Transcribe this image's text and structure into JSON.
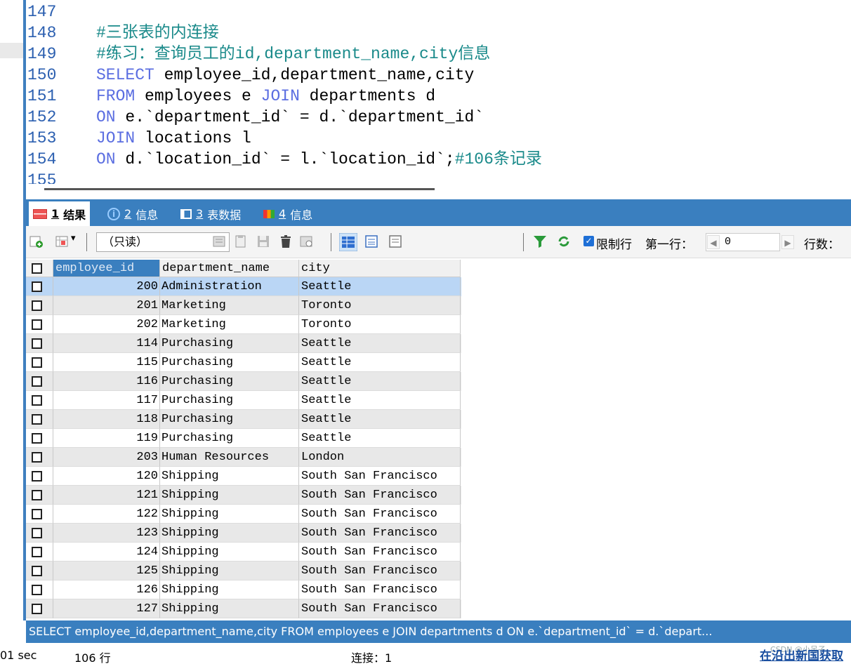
{
  "editor": {
    "lines": [
      {
        "num": "147",
        "parts": []
      },
      {
        "num": "148",
        "parts": [
          {
            "t": "cm",
            "v": "#三张表的内连接"
          }
        ]
      },
      {
        "num": "149",
        "parts": [
          {
            "t": "cm",
            "v": "#练习：查询员工的id,department_name,city信息"
          }
        ]
      },
      {
        "num": "150",
        "parts": [
          {
            "t": "kw",
            "v": "SELECT"
          },
          {
            "t": "str",
            "v": " employee_id,department_name,city"
          }
        ]
      },
      {
        "num": "151",
        "parts": [
          {
            "t": "kw",
            "v": "FROM"
          },
          {
            "t": "str",
            "v": " employees e "
          },
          {
            "t": "kw",
            "v": "JOIN"
          },
          {
            "t": "str",
            "v": " departments d"
          }
        ]
      },
      {
        "num": "152",
        "parts": [
          {
            "t": "kw",
            "v": "ON"
          },
          {
            "t": "str",
            "v": " e.`department_id` = d.`department_id`"
          }
        ]
      },
      {
        "num": "153",
        "parts": [
          {
            "t": "kw",
            "v": "JOIN"
          },
          {
            "t": "str",
            "v": " locations l"
          }
        ]
      },
      {
        "num": "154",
        "parts": [
          {
            "t": "kw",
            "v": "ON"
          },
          {
            "t": "str",
            "v": " d.`location_id` = l.`location_id`;"
          },
          {
            "t": "cm",
            "v": "#106条记录"
          }
        ]
      },
      {
        "num": "155",
        "parts": []
      }
    ]
  },
  "tabs": [
    {
      "num": "1",
      "label": "结果"
    },
    {
      "num": "2",
      "label": "信息"
    },
    {
      "num": "3",
      "label": "表数据"
    },
    {
      "num": "4",
      "label": "信息"
    }
  ],
  "toolbar": {
    "readonly": "（只读）",
    "limit_label": "限制行",
    "first_row_label": "第一行：",
    "first_row_value": "0",
    "rows_label": "行数："
  },
  "grid": {
    "columns": [
      "employee_id",
      "department_name",
      "city"
    ],
    "rows": [
      [
        "200",
        "Administration",
        "Seattle"
      ],
      [
        "201",
        "Marketing",
        "Toronto"
      ],
      [
        "202",
        "Marketing",
        "Toronto"
      ],
      [
        "114",
        "Purchasing",
        "Seattle"
      ],
      [
        "115",
        "Purchasing",
        "Seattle"
      ],
      [
        "116",
        "Purchasing",
        "Seattle"
      ],
      [
        "117",
        "Purchasing",
        "Seattle"
      ],
      [
        "118",
        "Purchasing",
        "Seattle"
      ],
      [
        "119",
        "Purchasing",
        "Seattle"
      ],
      [
        "203",
        "Human Resources",
        "London"
      ],
      [
        "120",
        "Shipping",
        "South San Francisco"
      ],
      [
        "121",
        "Shipping",
        "South San Francisco"
      ],
      [
        "122",
        "Shipping",
        "South San Francisco"
      ],
      [
        "123",
        "Shipping",
        "South San Francisco"
      ],
      [
        "124",
        "Shipping",
        "South San Francisco"
      ],
      [
        "125",
        "Shipping",
        "South San Francisco"
      ],
      [
        "126",
        "Shipping",
        "South San Francisco"
      ],
      [
        "127",
        "Shipping",
        "South San Francisco"
      ]
    ]
  },
  "sqlbar": "SELECT employee_id,department_name,city FROM employees e JOIN departments d ON e.`department_id` = d.`depart...",
  "status": {
    "time": "01 sec",
    "rows": "106 行",
    "connection": "连接：1",
    "watermark_small": "CSDN @小呆子",
    "watermark": "在沿出新国获取"
  },
  "colors": {
    "accent": "#3a7fbf",
    "keyword": "#5b6ee1",
    "comment": "#1a8a8a",
    "selected_row": "#bad6f5"
  }
}
